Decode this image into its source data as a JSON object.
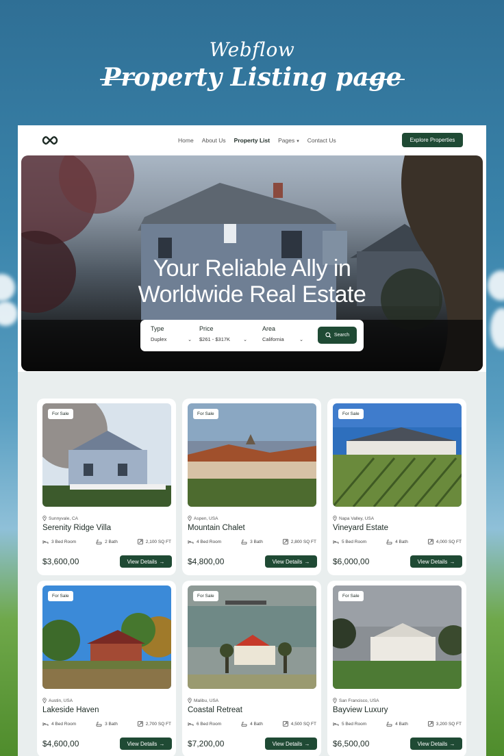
{
  "promo": {
    "brand": "Webflow",
    "title": "Property Listing page"
  },
  "nav": {
    "links": [
      {
        "label": "Home"
      },
      {
        "label": "About Us"
      },
      {
        "label": "Property List"
      },
      {
        "label": "Pages"
      },
      {
        "label": "Contact Us"
      }
    ],
    "cta": "Explore Properties"
  },
  "hero": {
    "title_line1": "Your Reliable Ally in",
    "title_line2": "Worldwide Real Estate",
    "search": {
      "type_label": "Type",
      "type_value": "Duplex",
      "price_label": "Price",
      "price_value": "$261 - $317K",
      "area_label": "Area",
      "area_value": "California",
      "button": "Search"
    }
  },
  "listings": [
    {
      "badge": "For Sale",
      "location": "Sunnyvale, CA",
      "name": "Serenity Ridge Villa",
      "beds": "3 Bed Room",
      "baths": "2 Bath",
      "area": "2,100 SQ FT",
      "price": "$3,600,00",
      "cta": "View Details"
    },
    {
      "badge": "For Sale",
      "location": "Aspen, USA",
      "name": "Mountain Chalet",
      "beds": "4 Bed Room",
      "baths": "3 Bath",
      "area": "2,800 SQ FT",
      "price": "$4,800,00",
      "cta": "View Details"
    },
    {
      "badge": "For Sale",
      "location": "Napa Valley, USA",
      "name": "Vineyard Estate",
      "beds": "5 Bed Room",
      "baths": "4 Bath",
      "area": "4,000 SQ FT",
      "price": "$6,000,00",
      "cta": "View Details"
    },
    {
      "badge": "For Sale",
      "location": "Austin, USA",
      "name": "Lakeside Haven",
      "beds": "4 Bed Room",
      "baths": "3 Bath",
      "area": "2,700 SQ FT",
      "price": "$4,600,00",
      "cta": "View Details"
    },
    {
      "badge": "For Sale",
      "location": "Malibu, USA",
      "name": "Coastal Retreat",
      "beds": "6 Bed Room",
      "baths": "4 Bath",
      "area": "4,500 SQ FT",
      "price": "$7,200,00",
      "cta": "View Details"
    },
    {
      "badge": "For Sale",
      "location": "San Francisco, USA",
      "name": "Bayview Luxury",
      "beds": "5 Bed Room",
      "baths": "4 Bath",
      "area": "3,200 SQ FT",
      "price": "$6,500,00",
      "cta": "View Details"
    }
  ],
  "colors": {
    "accent": "#1f4a34",
    "text": "#1c2a24",
    "listing_bg": "#e9eeee"
  }
}
